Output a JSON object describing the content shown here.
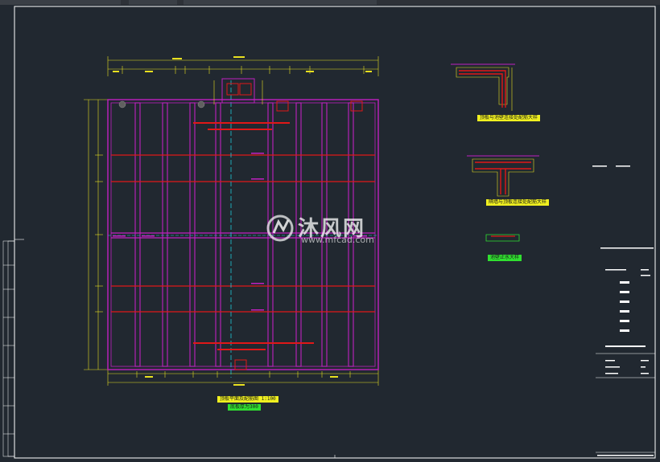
{
  "colors": {
    "background": "#212830",
    "frame": "#ffffff",
    "grid_magenta": "#c020c0",
    "grid_red": "#e01818",
    "dimension": "#e8e020",
    "centerline": "#20c8d8",
    "caption_bg": "#f0f020",
    "caption_green": "#30e030"
  },
  "watermark": {
    "brand": "沐风网",
    "url": "www.mfcad.com",
    "logo_icon": "mf-logo-icon"
  },
  "drawing": {
    "main_caption": "顶板平面及配筋图 1:100",
    "main_subcaption": "底板厚为300",
    "detail1_caption": "顶板与池壁连接处配筋大样",
    "detail2_caption": "隔墙与顶板连接处配筋大样",
    "detail3_caption": "池壁止水大样"
  }
}
